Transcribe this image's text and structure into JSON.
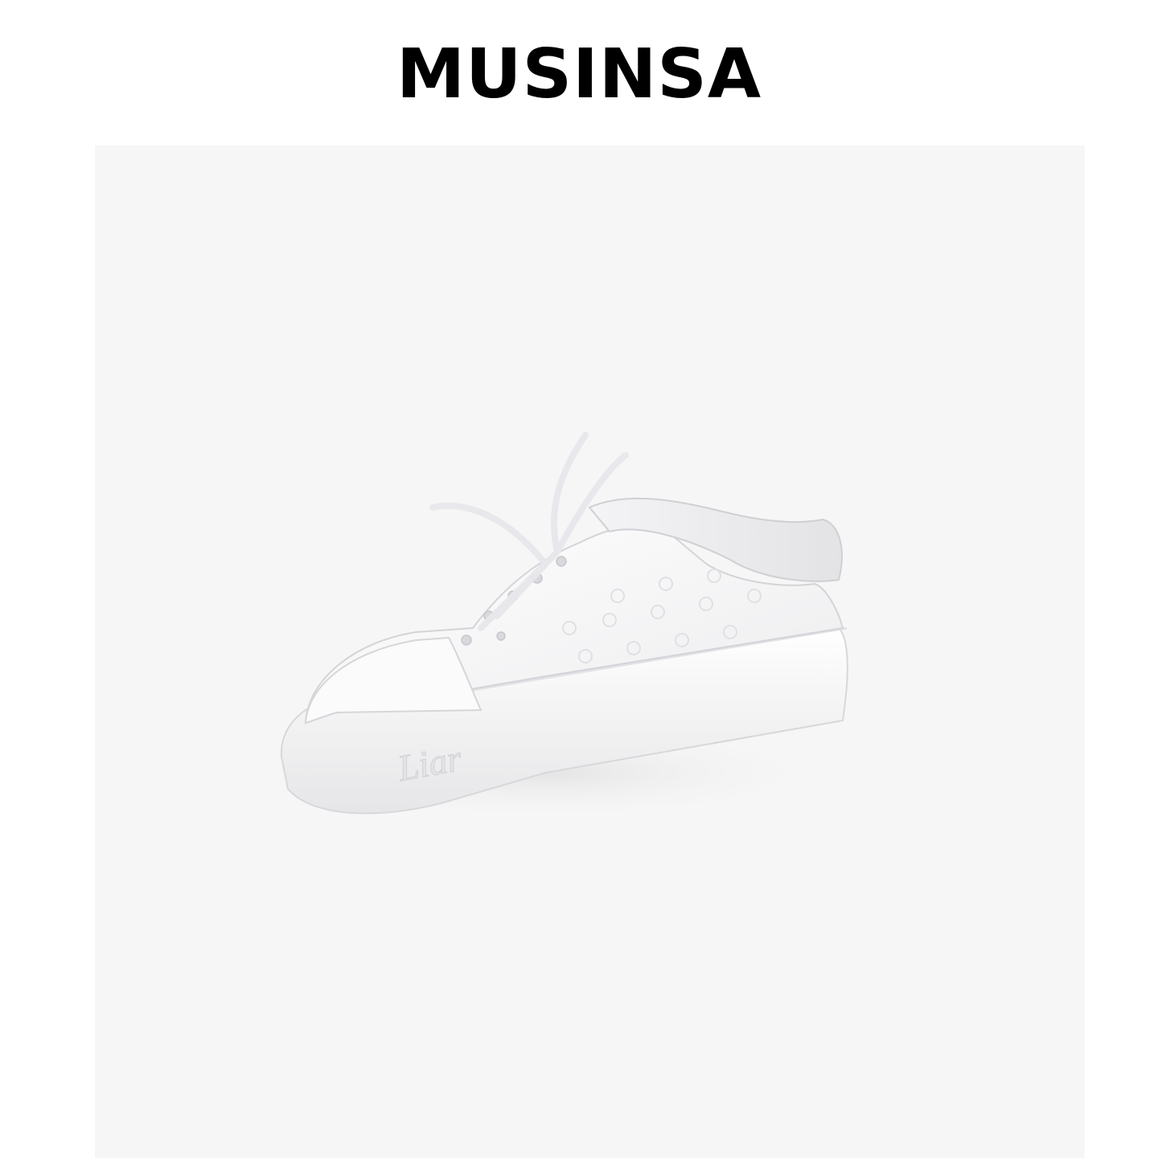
{
  "brand": {
    "logo_text": "MUSINSA"
  },
  "product": {
    "image_description_name": "white-leather-sneaker-photo",
    "sole_lettering": "Liar"
  },
  "colors": {
    "page_background": "#ffffff",
    "panel_background": "#f6f6f6",
    "logo": "#000000",
    "shoe": "#ffffff"
  }
}
